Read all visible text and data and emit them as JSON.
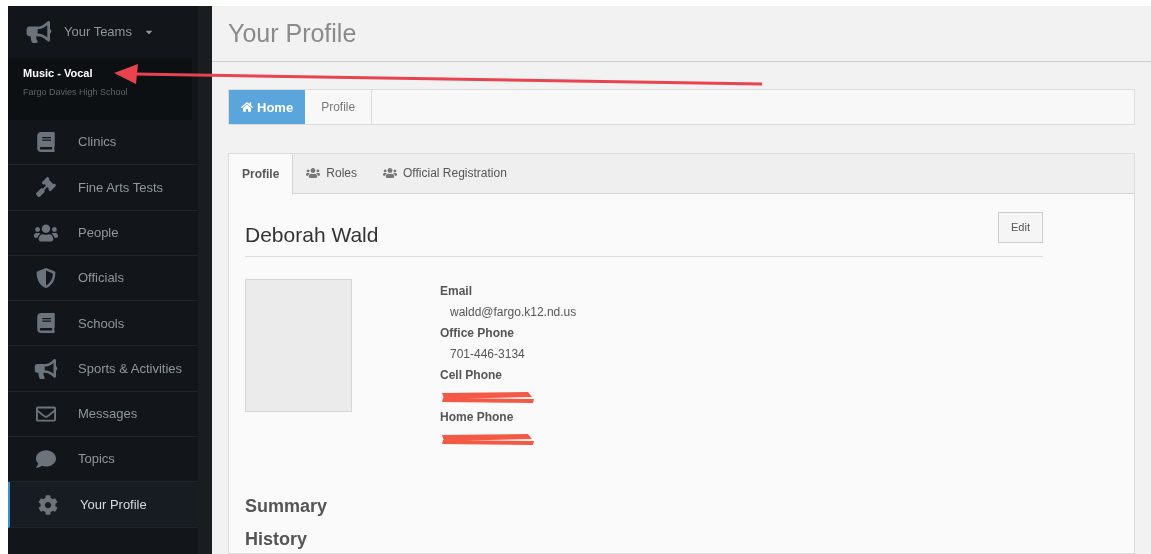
{
  "sidebar": {
    "teams_menu": {
      "label": "Your Teams",
      "expanded": false
    },
    "team": {
      "name": "Music - Vocal",
      "school": "Fargo Davies High School"
    },
    "items": [
      {
        "label": "Clinics",
        "selected": false
      },
      {
        "label": "Fine Arts Tests",
        "selected": false
      },
      {
        "label": "People",
        "selected": false
      },
      {
        "label": "Officials",
        "selected": false
      },
      {
        "label": "Schools",
        "selected": false
      },
      {
        "label": "Sports & Activities",
        "selected": false
      },
      {
        "label": "Messages",
        "selected": false
      },
      {
        "label": "Topics",
        "selected": false
      },
      {
        "label": "Your Profile",
        "selected": true
      }
    ]
  },
  "page_title": "Your Profile",
  "breadcrumb": [
    {
      "label": "Home",
      "kind": "home"
    },
    {
      "label": "Profile",
      "kind": "page"
    }
  ],
  "tabs": [
    {
      "label": "Profile",
      "selected": true
    },
    {
      "label": "Roles",
      "selected": false
    },
    {
      "label": "Official Registration",
      "selected": false
    }
  ],
  "profile": {
    "name": "Deborah Wald",
    "edit_button": "Edit",
    "fields": [
      {
        "label": "Email",
        "value": "waldd@fargo.k12.nd.us",
        "kind": "text"
      },
      {
        "label": "Office Phone",
        "value": "701-446-3134",
        "kind": "text"
      },
      {
        "label": "Cell Phone",
        "kind": "redacted"
      },
      {
        "label": "Home Phone",
        "kind": "redacted"
      }
    ],
    "sections": [
      "Summary",
      "History"
    ]
  }
}
